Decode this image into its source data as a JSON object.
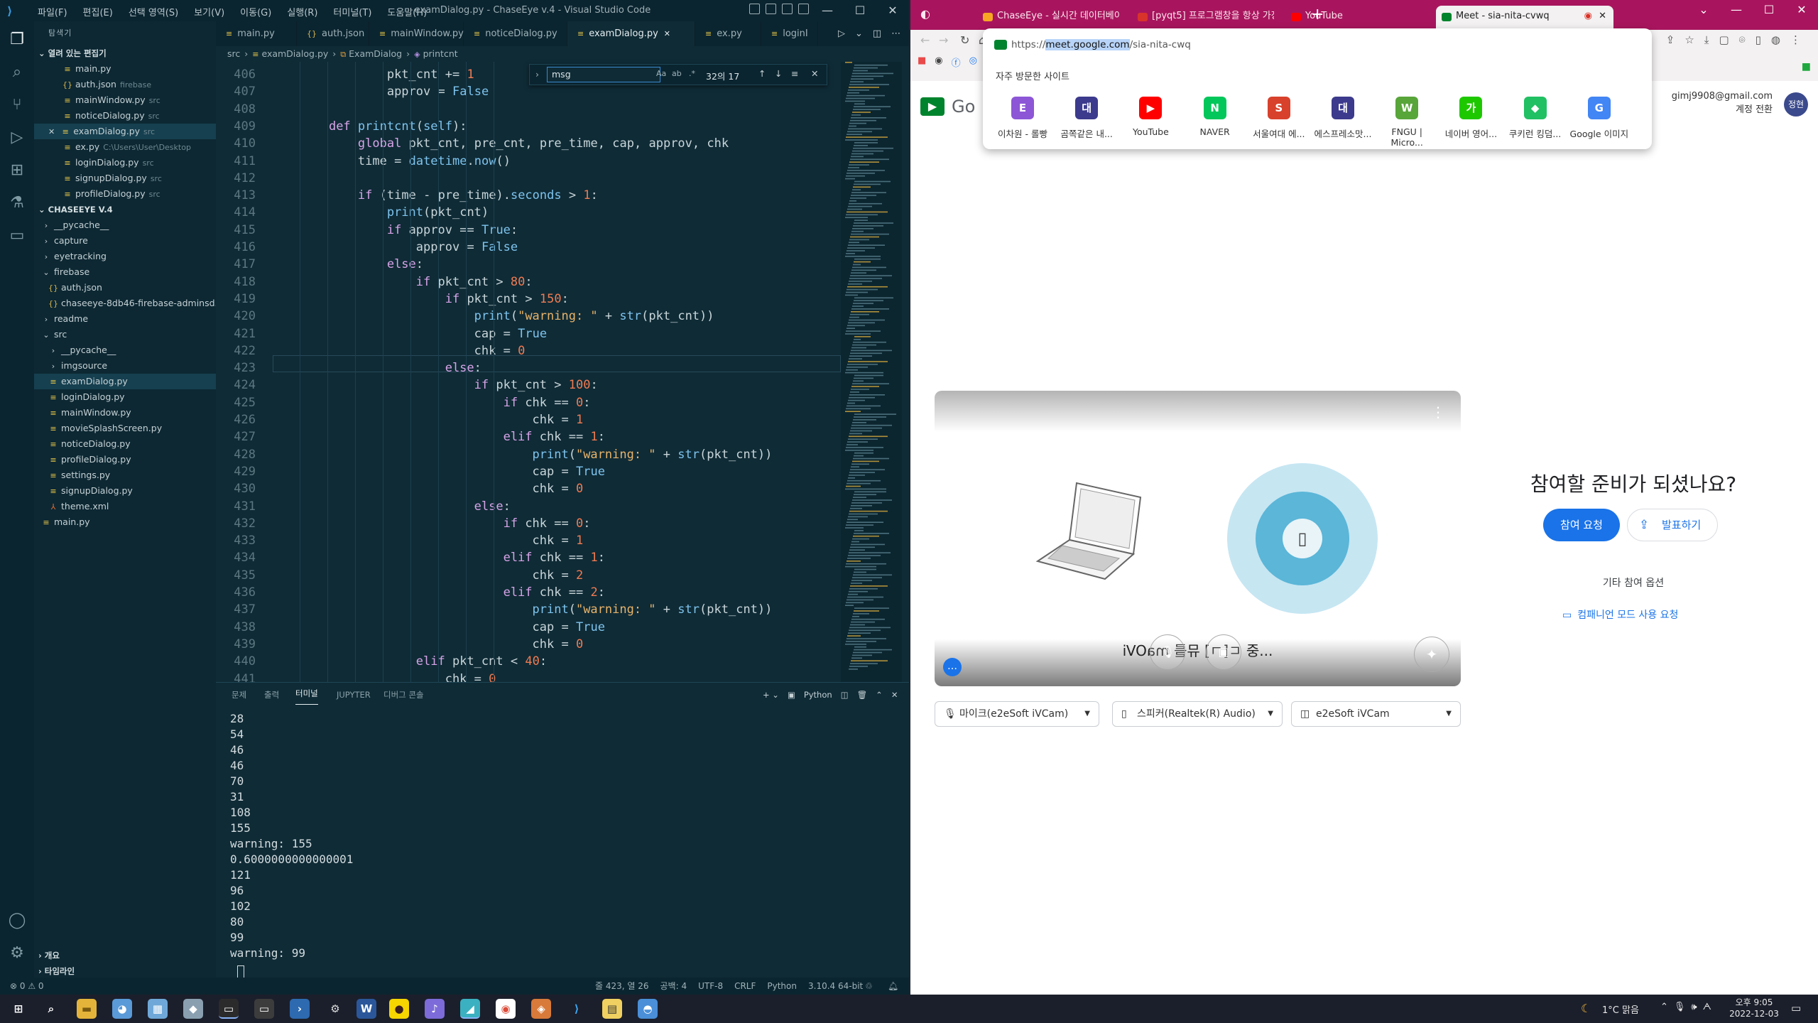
{
  "vscode": {
    "menu": [
      "파일(F)",
      "편집(E)",
      "선택 영역(S)",
      "보기(V)",
      "이동(G)",
      "실행(R)",
      "터미널(T)",
      "도움말(H)"
    ],
    "title": "examDialog.py - ChaseEye v.4 - Visual Studio Code",
    "explorer_header": "탐색기",
    "open_editors_label": "열려 있는 편집기",
    "open_editors": [
      {
        "name": "main.py",
        "desc": "",
        "type": "py"
      },
      {
        "name": "auth.json",
        "desc": "firebase",
        "type": "json"
      },
      {
        "name": "mainWindow.py",
        "desc": "src",
        "type": "py"
      },
      {
        "name": "noticeDialog.py",
        "desc": "src",
        "type": "py"
      },
      {
        "name": "examDialog.py",
        "desc": "src",
        "type": "py",
        "active": true
      },
      {
        "name": "ex.py",
        "desc": "C:\\Users\\User\\Desktop",
        "type": "py"
      },
      {
        "name": "loginDialog.py",
        "desc": "src",
        "type": "py"
      },
      {
        "name": "signupDialog.py",
        "desc": "src",
        "type": "py"
      },
      {
        "name": "profileDialog.py",
        "desc": "src",
        "type": "py"
      }
    ],
    "project_label": "CHASEEYE V.4",
    "tree": [
      {
        "name": "__pycache__",
        "kind": "folder",
        "depth": 1
      },
      {
        "name": "capture",
        "kind": "folder",
        "depth": 1
      },
      {
        "name": "eyetracking",
        "kind": "folder",
        "depth": 1
      },
      {
        "name": "firebase",
        "kind": "folder-open",
        "depth": 1
      },
      {
        "name": "auth.json",
        "kind": "json",
        "depth": 2
      },
      {
        "name": "chaseeye-8db46-firebase-adminsd...",
        "kind": "json",
        "depth": 2
      },
      {
        "name": "readme",
        "kind": "folder",
        "depth": 1
      },
      {
        "name": "src",
        "kind": "folder-open",
        "depth": 1
      },
      {
        "name": "__pycache__",
        "kind": "folder",
        "depth": 2
      },
      {
        "name": "imgsource",
        "kind": "folder",
        "depth": 2
      },
      {
        "name": "examDialog.py",
        "kind": "py",
        "depth": 2,
        "selected": true
      },
      {
        "name": "loginDialog.py",
        "kind": "py",
        "depth": 2
      },
      {
        "name": "mainWindow.py",
        "kind": "py",
        "depth": 2
      },
      {
        "name": "movieSplashScreen.py",
        "kind": "py",
        "depth": 2
      },
      {
        "name": "noticeDialog.py",
        "kind": "py",
        "depth": 2
      },
      {
        "name": "profileDialog.py",
        "kind": "py",
        "depth": 2
      },
      {
        "name": "settings.py",
        "kind": "py",
        "depth": 2
      },
      {
        "name": "signupDialog.py",
        "kind": "py",
        "depth": 2
      },
      {
        "name": "theme.xml",
        "kind": "xml",
        "depth": 2
      },
      {
        "name": "main.py",
        "kind": "py",
        "depth": 1
      }
    ],
    "outline_label": "개요",
    "timeline_label": "타임라인",
    "tabs": [
      "main.py",
      "auth.json",
      "mainWindow.py",
      "noticeDialog.py",
      "examDialog.py",
      "ex.py",
      "loginI"
    ],
    "breadcrumb": [
      "src",
      "examDialog.py",
      "ExamDialog",
      "printcnt"
    ],
    "find": {
      "query": "msg",
      "result": "32의 17"
    },
    "line_numbers": [
      "406",
      "407",
      "408",
      "409",
      "410",
      "411",
      "412",
      "413",
      "414",
      "415",
      "416",
      "417",
      "418",
      "419",
      "420",
      "421",
      "422",
      "423",
      "424",
      "425",
      "426",
      "427",
      "428",
      "429",
      "430",
      "431",
      "432",
      "433",
      "434",
      "435",
      "436",
      "437",
      "438",
      "439",
      "440",
      "441"
    ],
    "code_lines": [
      "            pkt_cnt += 1",
      "            approv = False",
      "",
      "    def printcnt(self):",
      "        global pkt_cnt, pre_cnt, pre_time, cap, approv, chk",
      "        time = datetime.now()",
      "",
      "        if (time - pre_time).seconds > 1:",
      "            print(pkt_cnt)",
      "            if approv == True:",
      "                approv = False",
      "            else:",
      "                if pkt_cnt > 80:",
      "                    if pkt_cnt > 150:",
      "                        print(\"warning: \" + str(pkt_cnt))",
      "                        cap = True",
      "                        chk = 0",
      "                    else:",
      "                        if pkt_cnt > 100:",
      "                            if chk == 0:",
      "                                chk = 1",
      "                            elif chk == 1:",
      "                                print(\"warning: \" + str(pkt_cnt))",
      "                                cap = True",
      "                                chk = 0",
      "                        else:",
      "                            if chk == 0:",
      "                                chk = 1",
      "                            elif chk == 1:",
      "                                chk = 2",
      "                            elif chk == 2:",
      "                                print(\"warning: \" + str(pkt_cnt))",
      "                                cap = True",
      "                                chk = 0",
      "                elif pkt_cnt < 40:",
      "                    chk = 0"
    ],
    "panel_tabs": [
      "문제",
      "출력",
      "터미널",
      "JUPYTER",
      "디버그 콘솔"
    ],
    "panel_active": "터미널",
    "terminal_kind": "Python",
    "terminal_lines": [
      "28",
      "54",
      "46",
      "46",
      "70",
      "31",
      "108",
      "155",
      "warning: 155",
      "0.6000000000000001",
      "121",
      "96",
      "102",
      "80",
      "99",
      "warning: 99"
    ],
    "status_left": "⊗ 0 ⚠ 0",
    "status_right": [
      "줄 423, 열 26",
      "공백: 4",
      "UTF-8",
      "CRLF",
      "Python",
      "3.10.4 64-bit"
    ]
  },
  "chrome": {
    "tabs": [
      {
        "label": "ChaseEye - 실시간 데이터베이...",
        "color": "#f6a623"
      },
      {
        "label": "[pyqt5] 프로그램창을 항상 가장...",
        "color": "#d9342b"
      },
      {
        "label": "YouTube",
        "color": "#ff0000"
      },
      {
        "label": "Meet - sia-nita-cvwq",
        "color": "#00832d",
        "active": true
      }
    ],
    "url_prefix": "https://",
    "url_host": "meet.google.com",
    "url_path": "/sia-nita-cwq",
    "frequent_label": "자주 방문한 사이트",
    "shortcuts": [
      {
        "label": "이차원 - 롤빵",
        "letter": "E",
        "color": "#8c56d6"
      },
      {
        "label": "곰쪽같은 내...",
        "letter": "대",
        "color": "#3b3a8c"
      },
      {
        "label": "YouTube",
        "letter": "▶",
        "color": "#ff0000"
      },
      {
        "label": "NAVER",
        "letter": "N",
        "color": "#03c75a"
      },
      {
        "label": "서울여대 에...",
        "letter": "S",
        "color": "#d8412b"
      },
      {
        "label": "에스프레소맛...",
        "letter": "대",
        "color": "#3b3a8c"
      },
      {
        "label": "FNGU | Micro...",
        "letter": "W",
        "color": "#58a53a"
      },
      {
        "label": "네이버 영어...",
        "letter": "가",
        "color": "#1ec800"
      },
      {
        "label": "쿠키런 킹덤...",
        "letter": "◆",
        "color": "#21c063"
      },
      {
        "label": "Google 이미지",
        "letter": "G",
        "color": "#4285f4"
      }
    ]
  },
  "meet": {
    "logo_text": "Go",
    "account_email": "gimj9908@gmail.com",
    "account_switch": "계정 전환",
    "avatar_text": "정현",
    "ready_title": "참여할 준비가 되셨나요?",
    "join_button": "참여 요청",
    "present_button": "발표하기",
    "other_options": "기타 참여 옵션",
    "companion_mode": "컴패니언 모드 사용 요청",
    "preview_mirrored_text": "...중 ㄷ[ㄱ] 뮤를 maOVi",
    "mic_label": "마이크(e2eSoft iVCam)",
    "speaker_label": "스피커(Realtek(R) Audio)",
    "camera_label": "e2eSoft iVCam"
  },
  "taskbar": {
    "weather": "1°C 맑음",
    "time": "오후 9:05",
    "date": "2022-12-03"
  }
}
